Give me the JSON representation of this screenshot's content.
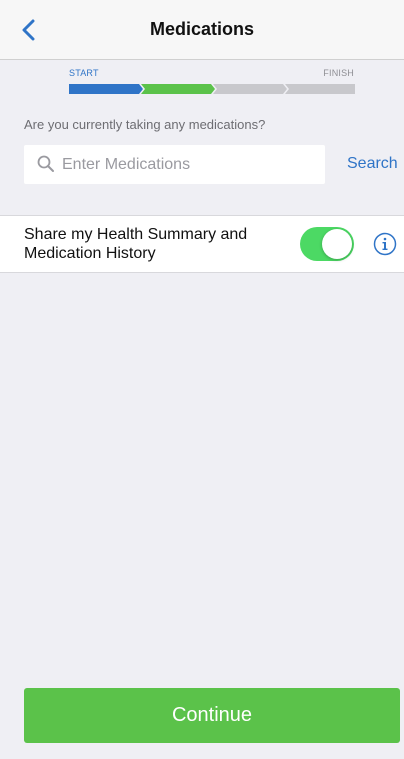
{
  "nav": {
    "title": "Medications",
    "back_icon": "chevron-left-icon"
  },
  "progress": {
    "start_label": "START",
    "finish_label": "FINISH",
    "total_steps": 4,
    "completed_steps": 2,
    "colors": [
      "#2f74c7",
      "#5bc24a",
      "#c8c8cc",
      "#c8c8cc"
    ]
  },
  "question": "Are you currently taking any medications?",
  "search": {
    "placeholder": "Enter Medications",
    "value": "",
    "button_label": "Search",
    "icon": "search-icon"
  },
  "share": {
    "label": "Share my Health Summary and Medication History",
    "toggle_on": true,
    "info_icon": "info-icon"
  },
  "continue_label": "Continue",
  "colors": {
    "accent_blue": "#2f74c7",
    "accent_green": "#5bc24a",
    "toggle_green": "#4cd964",
    "background": "#efeff4"
  }
}
